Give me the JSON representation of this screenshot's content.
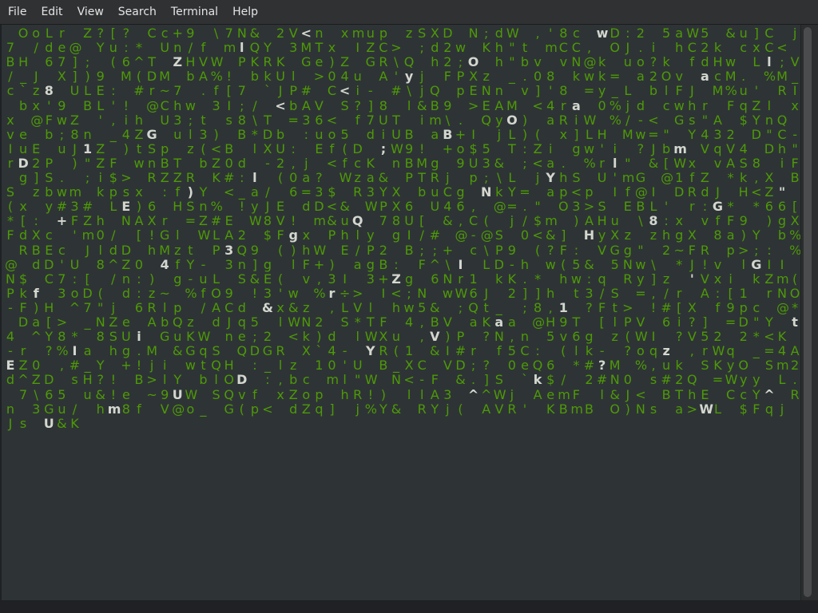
{
  "menu": {
    "items": [
      "File",
      "Edit",
      "View",
      "Search",
      "Terminal",
      "Help"
    ]
  },
  "terminal": {
    "rain_chars": "O o L r Z ? [ ? C c + 9 \\ 7 N & 2 V < n x m u p z S X D N ; d W , ' 8 c w D : 2 5 a W 5 & u ] C j 7 / d e @ Y u : * U n / f m l Q Y 3 M T x I Z C > ; d 2 w K h \" t m C C , O J . i h C 2 k c x C < B H 6 7 ] ; ( 6 ^ T Z H V W P K R K G e ) Z G R \\ Q h 2 ; O h \" b v v N @ k u o ? k f d H w L l ; V / _ J X ] ) 9 M ( D M b A % ! b k U l > 0 4 u A ' y j F P X z _ . 0 8 k w k = a 2 O v a c M . % M _ c ` z 8 U L E : # r ~ 7 . f [ 7 ` J P # C < i - # \\ j Q p E N n v ] ' 8 = y _ L b l F J M % u ' R I b x ' 9 B L ' ! @ C h w 3 I ; / < b A V S ? ] 8 l & B 9 > E A M < 4 r a 0 % j d c w h r F q Z l x x @ F w Z ' , i h U 3 ; t s 8 \\ T = 3 6 < f 7 U T i m \\ . Q y O ) a R i W % / - < G s \" A $ Y n Q v e b ; 8 n _ 4 Z G u l 3 ) B * D b : u o 5 d i U B a B + I j L ) ( x ] L H M w = \" Y 4 3 2 D \" C - I u E u J 1 Z ) t S p z ( < B l X U : E f ( D ; W 9 ! + o $ 5 T : Z i g w ' i ? J b m V q V 4 D h \" r D 2 P ) \" Z F w n B T b Z 0 d - 2 , j < f c K n B M g 9 U 3 & ; < a . % r l \" & [ W x v A S 8 i F g ] S . ; i $ > R Z Z R K # : l ( 0 a ? W z a & P T R j p ; \\ L j Y h S U ' m G @ 1 f Z * k , X B S z b w m k p s x : f ) Y < _ a / 6 = 3 $ R 3 Y X b u C g N k Y = a p < p I f @ I D R d J H < Z \" ( x y # 3 # L E ) 6 H S n % ! y J E d D < & W P X 6 U 4 6 , @ = . \" O 3 > S E B L ' r : G * * 6 6 [ * [ : + F Z h N A X r = Z # E W 8 V ! m & u Q 7 8 U [ & , C ( j / $ m ) A H u \\ 8 : x v f F 9 ) g X F d X c ' m 0 / [ ! G l W L A 2 $ F g x P h l y g I / # @ - @ S 0 < & ] H y X z z h g X 8 a ) Y b % R B E c J l d D h M z t P 3 Q 9 ( ) h W E / P 2 B ; ; + c \\ P 9 ( ? F : V G g \" 2 ~ F R p > ; : % @ d D ' U 8 ^ Z 0 4 f Y - 3 n ] g l F + ) a g B : F ^ \\ I L D - h w ( 5 & 5 N w \\ * J ! v l G I I N $ C 7 : [ / n : ) g - u L S & E ( v , 3 I 3 + Z g 6 N r 1 k K . * h w : q R y ] z ' V x i k Z m ( P k f 3 o D ( d : z ~ % f O 9 ! 3 ' w % r ÷ > I < ; N w W 6 J 2 ] ] h t 3 / S = , / r A : [ 1 r N O - F ) H ^ 7 \" j 6 R l p / A C d & x & z , L V l h w 5 & ; Q t _ ; 8 , 1 ? F t > ! # [ X f 9 p c @ * D a [ > _ N Z e A b Q z d J q 5 l W N 2 S * T F 4 , B V a K a a @ H 9 T [ l P V 6 i ? ] = D \" Y t 4 ^ Y 8 * 8 S U i G u K W n e ; 2 < k ) d l W X u , V ) P ? N , n 5 v 6 g z ( W I ? V 5 2 2 * < K - r ? % I a h g . M & G q S Q D G R X ` 4 - Y R ( 1 & I # r f 5 C : ( l k - ? o q z , r W q _ = 4 A E Z 0 , # _ Y + ! j i w t Q H : _ l z 1 0 ' U B _ X C V D ; ? 0 e Q 6 * # ? M % , u k S K y O S m 2 d ^ Z D s H ? ! B > l Y b l O D : , b c m l \" W N < - F & . ] S ` k $ / 2 # N 0 s # 2 Q = W y y L . 7 \\ 6 5 u & ! e ~ 9 U W S Q v f x Z o p h R ! ) l l A 3 ^ ^ W j A e m F l & J < B T h E C c Y ^ R n 3 G u / h m 8 f V @ o _ G ( p < d Z q ] j % Y & R Y j ( A V R ' K B m B O ) N s a > W L $ F q j J s U & K"
  },
  "colors": {
    "green": "#4e9a06",
    "white": "#d3d7cf",
    "terminal_bg": "#2e3436",
    "menubar_bg": "#2f3133"
  }
}
